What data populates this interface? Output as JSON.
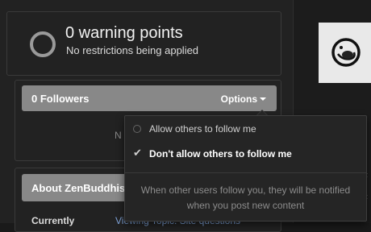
{
  "warning": {
    "title": "0 warning points",
    "subtitle": "No restrictions being applied"
  },
  "followers": {
    "title": "0 Followers",
    "options_label": "Options",
    "empty_text_fragment": "N"
  },
  "followers_menu": {
    "options": [
      {
        "label": "Allow others to follow me",
        "selected": false
      },
      {
        "label": "Don't allow others to follow me",
        "selected": true
      }
    ],
    "note_line1": "When other users follow you, they will be notified",
    "note_line2": "when you post new content"
  },
  "about": {
    "title": "About ZenBuddhis",
    "row_label": "Currently",
    "row_value": "Viewing Topic: Site questions"
  },
  "right_panel": {
    "glyph1": "‹",
    "glyph2": "‹"
  },
  "colors": {
    "page_bg": "#1a1a1a",
    "panel_bg": "#222222",
    "header_bar": "#888888",
    "menu_bg": "#252525",
    "link": "#7fa3d8"
  },
  "icons": [
    "warning-ring-icon",
    "caret-down-icon",
    "radio-icon",
    "checkmark-icon",
    "avatar-image"
  ]
}
